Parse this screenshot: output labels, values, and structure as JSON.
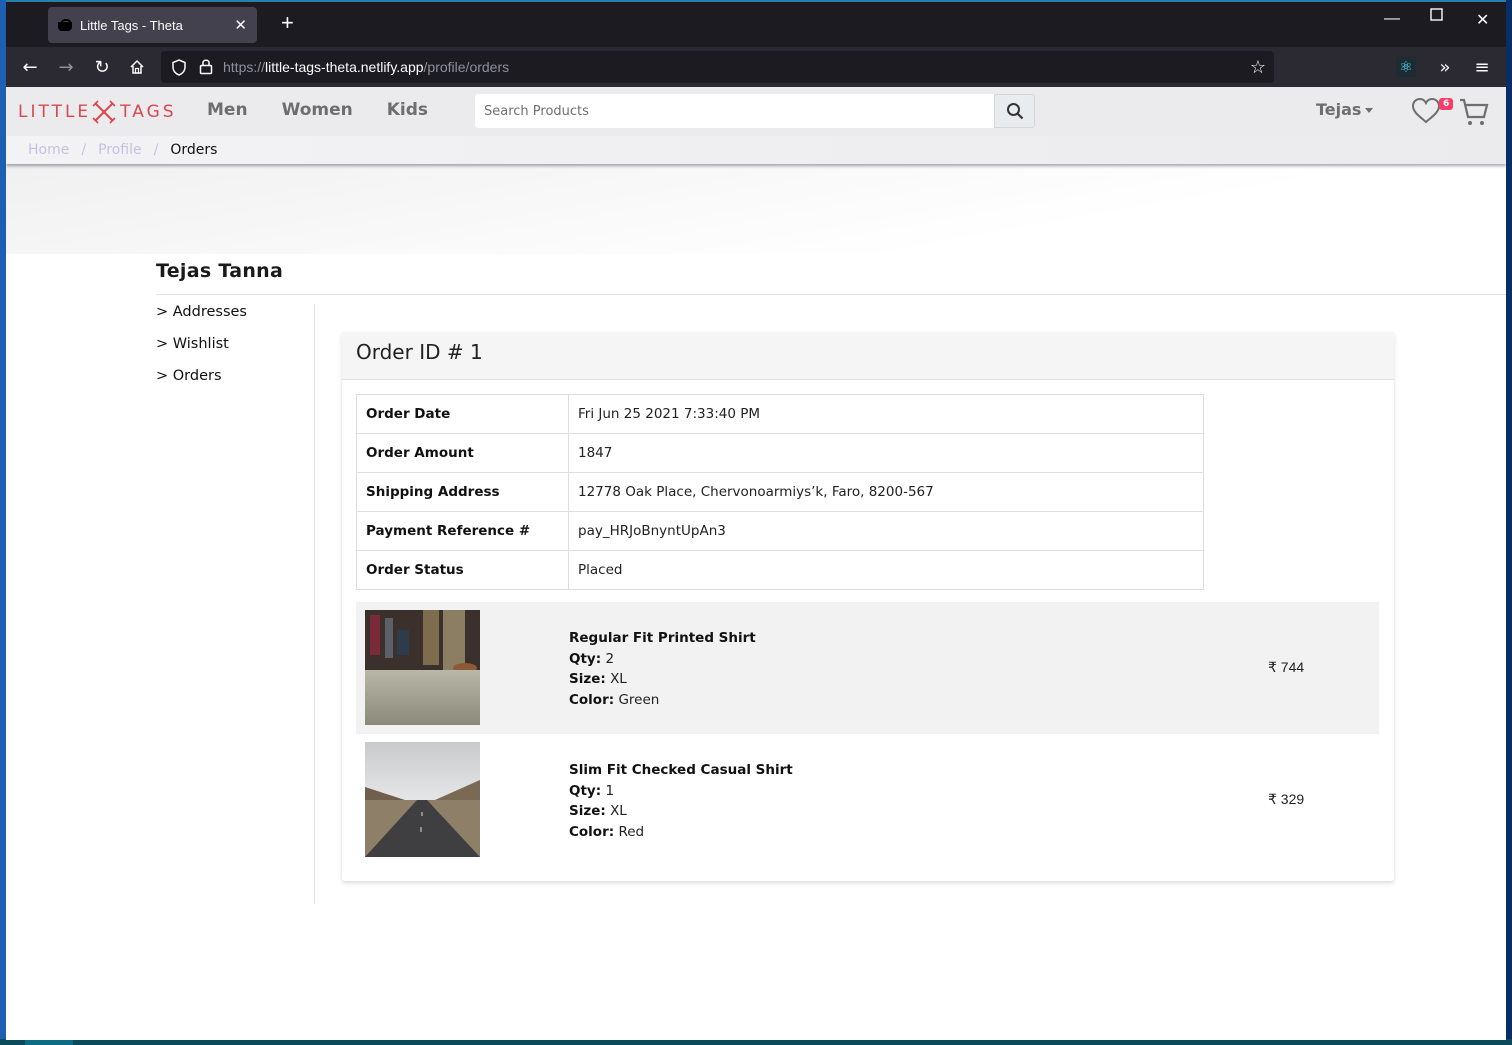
{
  "browser": {
    "tab_title": "Little Tags - Theta",
    "new_tab_label": "+",
    "url_scheme": "https://",
    "url_host": "little-tags-theta.netlify.app",
    "url_path": "/profile/orders"
  },
  "site": {
    "brand_left": "LITTLE",
    "brand_right": "TAGS",
    "brand_color": "#d9484f",
    "nav": [
      "Men",
      "Women",
      "Kids"
    ],
    "search_placeholder": "Search Products",
    "user_name": "Tejas",
    "wishlist_count": "6"
  },
  "breadcrumb": {
    "items": [
      "Home",
      "Profile"
    ],
    "separator": "/",
    "current": "Orders"
  },
  "profile": {
    "name": "Tejas Tanna",
    "menu": [
      "> Addresses",
      "> Wishlist",
      "> Orders"
    ]
  },
  "order": {
    "title": "Order ID # 1",
    "details": [
      {
        "label": "Order Date",
        "value": "Fri Jun 25 2021 7:33:40 PM"
      },
      {
        "label": "Order Amount",
        "value": "1847"
      },
      {
        "label": "Shipping Address",
        "value": "12778 Oak Place, Chervonoarmiys’k, Faro, 8200-567"
      },
      {
        "label": "Payment Reference #",
        "value": "pay_HRJoBnyntUpAn3"
      },
      {
        "label": "Order Status",
        "value": "Placed"
      }
    ],
    "qty_label": "Qty:",
    "size_label": "Size:",
    "color_label": "Color:",
    "items": [
      {
        "name": "Regular Fit Printed Shirt",
        "qty": "2",
        "size": "XL",
        "color": "Green",
        "price": "₹ 744",
        "image": "people-on-train-floor-photo"
      },
      {
        "name": "Slim Fit Checked Casual Shirt",
        "qty": "1",
        "size": "XL",
        "color": "Red",
        "price": "₹ 329",
        "image": "empty-road-landscape-photo"
      }
    ]
  }
}
